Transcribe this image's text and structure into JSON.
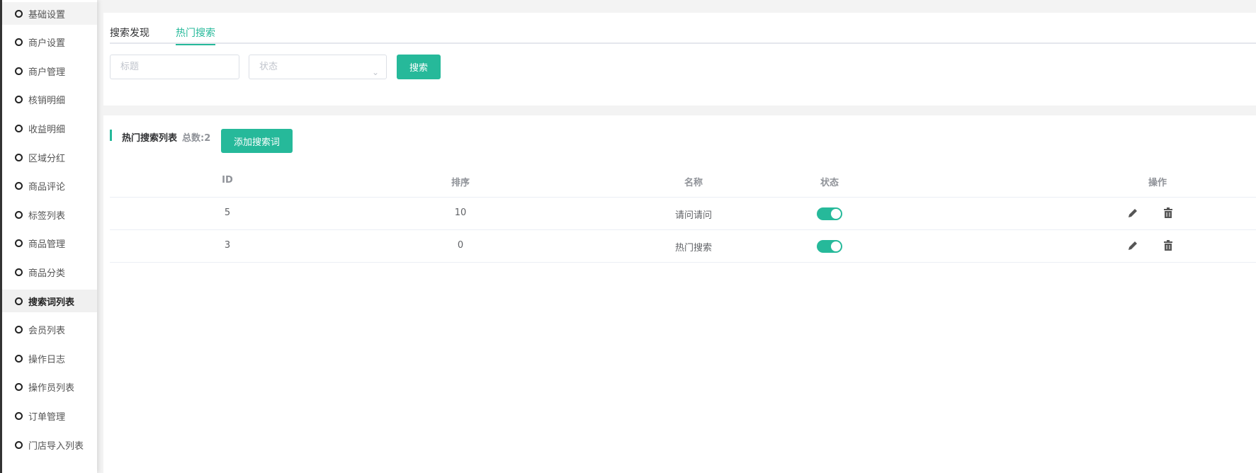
{
  "sidebar": {
    "items": [
      "基础设置",
      "商户设置",
      "商户管理",
      "核销明细",
      "收益明细",
      "区域分红",
      "商品评论",
      "标签列表",
      "商品管理",
      "商品分类",
      "搜索词列表",
      "会员列表",
      "操作日志",
      "操作员列表",
      "订单管理",
      "门店导入列表"
    ],
    "active_index": 10
  },
  "tabs": [
    "搜索发现",
    "热门搜索"
  ],
  "active_tab": 1,
  "filters": {
    "title_placeholder": "标题",
    "status_placeholder": "状态",
    "search_label": "搜索"
  },
  "list": {
    "title": "热门搜索列表",
    "total": "总数:2",
    "add_label": "添加搜索词"
  },
  "table": {
    "headers": [
      "ID",
      "排序",
      "名称",
      "状态",
      "操作"
    ],
    "rows": [
      {
        "id": "5",
        "sort": "10",
        "name": "请问请问",
        "status": true
      },
      {
        "id": "3",
        "sort": "0",
        "name": "热门搜索",
        "status": true
      }
    ]
  },
  "colors": {
    "accent": "#26b99a"
  }
}
